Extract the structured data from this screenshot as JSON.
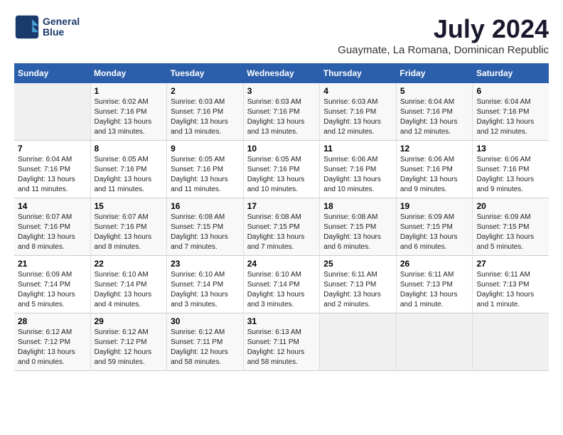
{
  "header": {
    "logo": {
      "line1": "General",
      "line2": "Blue"
    },
    "title": "July 2024",
    "subtitle": "Guaymate, La Romana, Dominican Republic"
  },
  "weekdays": [
    "Sunday",
    "Monday",
    "Tuesday",
    "Wednesday",
    "Thursday",
    "Friday",
    "Saturday"
  ],
  "weeks": [
    [
      {
        "day": "",
        "info": ""
      },
      {
        "day": "1",
        "info": "Sunrise: 6:02 AM\nSunset: 7:16 PM\nDaylight: 13 hours\nand 13 minutes."
      },
      {
        "day": "2",
        "info": "Sunrise: 6:03 AM\nSunset: 7:16 PM\nDaylight: 13 hours\nand 13 minutes."
      },
      {
        "day": "3",
        "info": "Sunrise: 6:03 AM\nSunset: 7:16 PM\nDaylight: 13 hours\nand 13 minutes."
      },
      {
        "day": "4",
        "info": "Sunrise: 6:03 AM\nSunset: 7:16 PM\nDaylight: 13 hours\nand 12 minutes."
      },
      {
        "day": "5",
        "info": "Sunrise: 6:04 AM\nSunset: 7:16 PM\nDaylight: 13 hours\nand 12 minutes."
      },
      {
        "day": "6",
        "info": "Sunrise: 6:04 AM\nSunset: 7:16 PM\nDaylight: 13 hours\nand 12 minutes."
      }
    ],
    [
      {
        "day": "7",
        "info": "Sunrise: 6:04 AM\nSunset: 7:16 PM\nDaylight: 13 hours\nand 11 minutes."
      },
      {
        "day": "8",
        "info": "Sunrise: 6:05 AM\nSunset: 7:16 PM\nDaylight: 13 hours\nand 11 minutes."
      },
      {
        "day": "9",
        "info": "Sunrise: 6:05 AM\nSunset: 7:16 PM\nDaylight: 13 hours\nand 11 minutes."
      },
      {
        "day": "10",
        "info": "Sunrise: 6:05 AM\nSunset: 7:16 PM\nDaylight: 13 hours\nand 10 minutes."
      },
      {
        "day": "11",
        "info": "Sunrise: 6:06 AM\nSunset: 7:16 PM\nDaylight: 13 hours\nand 10 minutes."
      },
      {
        "day": "12",
        "info": "Sunrise: 6:06 AM\nSunset: 7:16 PM\nDaylight: 13 hours\nand 9 minutes."
      },
      {
        "day": "13",
        "info": "Sunrise: 6:06 AM\nSunset: 7:16 PM\nDaylight: 13 hours\nand 9 minutes."
      }
    ],
    [
      {
        "day": "14",
        "info": "Sunrise: 6:07 AM\nSunset: 7:16 PM\nDaylight: 13 hours\nand 8 minutes."
      },
      {
        "day": "15",
        "info": "Sunrise: 6:07 AM\nSunset: 7:16 PM\nDaylight: 13 hours\nand 8 minutes."
      },
      {
        "day": "16",
        "info": "Sunrise: 6:08 AM\nSunset: 7:15 PM\nDaylight: 13 hours\nand 7 minutes."
      },
      {
        "day": "17",
        "info": "Sunrise: 6:08 AM\nSunset: 7:15 PM\nDaylight: 13 hours\nand 7 minutes."
      },
      {
        "day": "18",
        "info": "Sunrise: 6:08 AM\nSunset: 7:15 PM\nDaylight: 13 hours\nand 6 minutes."
      },
      {
        "day": "19",
        "info": "Sunrise: 6:09 AM\nSunset: 7:15 PM\nDaylight: 13 hours\nand 6 minutes."
      },
      {
        "day": "20",
        "info": "Sunrise: 6:09 AM\nSunset: 7:15 PM\nDaylight: 13 hours\nand 5 minutes."
      }
    ],
    [
      {
        "day": "21",
        "info": "Sunrise: 6:09 AM\nSunset: 7:14 PM\nDaylight: 13 hours\nand 5 minutes."
      },
      {
        "day": "22",
        "info": "Sunrise: 6:10 AM\nSunset: 7:14 PM\nDaylight: 13 hours\nand 4 minutes."
      },
      {
        "day": "23",
        "info": "Sunrise: 6:10 AM\nSunset: 7:14 PM\nDaylight: 13 hours\nand 3 minutes."
      },
      {
        "day": "24",
        "info": "Sunrise: 6:10 AM\nSunset: 7:14 PM\nDaylight: 13 hours\nand 3 minutes."
      },
      {
        "day": "25",
        "info": "Sunrise: 6:11 AM\nSunset: 7:13 PM\nDaylight: 13 hours\nand 2 minutes."
      },
      {
        "day": "26",
        "info": "Sunrise: 6:11 AM\nSunset: 7:13 PM\nDaylight: 13 hours\nand 1 minute."
      },
      {
        "day": "27",
        "info": "Sunrise: 6:11 AM\nSunset: 7:13 PM\nDaylight: 13 hours\nand 1 minute."
      }
    ],
    [
      {
        "day": "28",
        "info": "Sunrise: 6:12 AM\nSunset: 7:12 PM\nDaylight: 13 hours\nand 0 minutes."
      },
      {
        "day": "29",
        "info": "Sunrise: 6:12 AM\nSunset: 7:12 PM\nDaylight: 12 hours\nand 59 minutes."
      },
      {
        "day": "30",
        "info": "Sunrise: 6:12 AM\nSunset: 7:11 PM\nDaylight: 12 hours\nand 58 minutes."
      },
      {
        "day": "31",
        "info": "Sunrise: 6:13 AM\nSunset: 7:11 PM\nDaylight: 12 hours\nand 58 minutes."
      },
      {
        "day": "",
        "info": ""
      },
      {
        "day": "",
        "info": ""
      },
      {
        "day": "",
        "info": ""
      }
    ]
  ]
}
